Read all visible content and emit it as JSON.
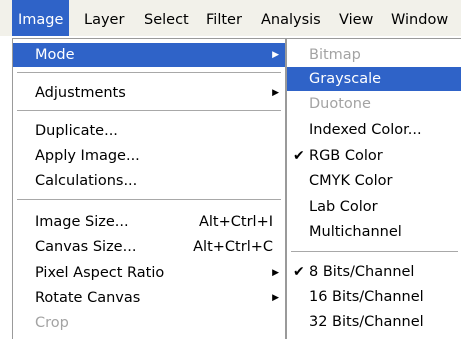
{
  "menubar": {
    "items": [
      "Image",
      "Layer",
      "Select",
      "Filter",
      "Analysis",
      "View",
      "Window"
    ]
  },
  "image_menu": {
    "items": [
      {
        "label": "Mode",
        "shortcut": "",
        "submenu": true,
        "disabled": false,
        "highlighted": true
      },
      {
        "label": "Adjustments",
        "shortcut": "",
        "submenu": true,
        "disabled": false
      },
      {
        "label": "Duplicate...",
        "shortcut": "",
        "disabled": false
      },
      {
        "label": "Apply Image...",
        "shortcut": "",
        "disabled": false
      },
      {
        "label": "Calculations...",
        "shortcut": "",
        "disabled": false
      },
      {
        "label": "Image Size...",
        "shortcut": "Alt+Ctrl+I",
        "disabled": false
      },
      {
        "label": "Canvas Size...",
        "shortcut": "Alt+Ctrl+C",
        "disabled": false
      },
      {
        "label": "Pixel Aspect Ratio",
        "shortcut": "",
        "submenu": true,
        "disabled": false
      },
      {
        "label": "Rotate Canvas",
        "shortcut": "",
        "submenu": true,
        "disabled": false
      },
      {
        "label": "Crop",
        "shortcut": "",
        "disabled": true
      }
    ]
  },
  "mode_menu": {
    "items": [
      {
        "label": "Bitmap",
        "disabled": true
      },
      {
        "label": "Grayscale",
        "highlighted": true
      },
      {
        "label": "Duotone",
        "disabled": true
      },
      {
        "label": "Indexed Color..."
      },
      {
        "label": "RGB Color",
        "checked": true
      },
      {
        "label": "CMYK Color"
      },
      {
        "label": "Lab Color"
      },
      {
        "label": "Multichannel"
      },
      {
        "label": "8 Bits/Channel",
        "checked": true
      },
      {
        "label": "16 Bits/Channel"
      },
      {
        "label": "32 Bits/Channel"
      }
    ],
    "check_glyph": "✔",
    "arrow_glyph": "▶"
  }
}
